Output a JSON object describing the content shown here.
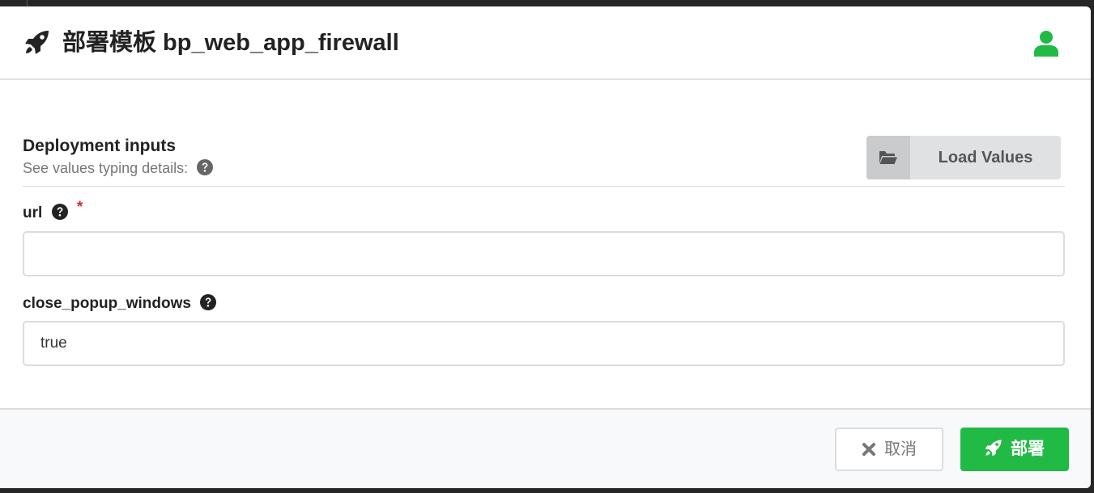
{
  "modal": {
    "title": "部署模板 bp_web_app_firewall",
    "header_icon": "rocket-icon",
    "user_icon": "user-icon"
  },
  "section": {
    "title": "Deployment inputs",
    "subtitle": "See values typing details:",
    "load_values_label": "Load Values",
    "load_values_icon": "folder-open-icon"
  },
  "inputs": [
    {
      "label": "url",
      "required": true,
      "value": "",
      "placeholder": ""
    },
    {
      "label": "close_popup_windows",
      "required": false,
      "value": "true",
      "placeholder": ""
    }
  ],
  "footer": {
    "cancel_label": "取消",
    "deploy_label": "部署"
  },
  "colors": {
    "deploy_green": "#21ba45",
    "user_icon_green": "#21ba45",
    "required_red": "#db2828",
    "load_button_bg": "#e0e1e2"
  }
}
